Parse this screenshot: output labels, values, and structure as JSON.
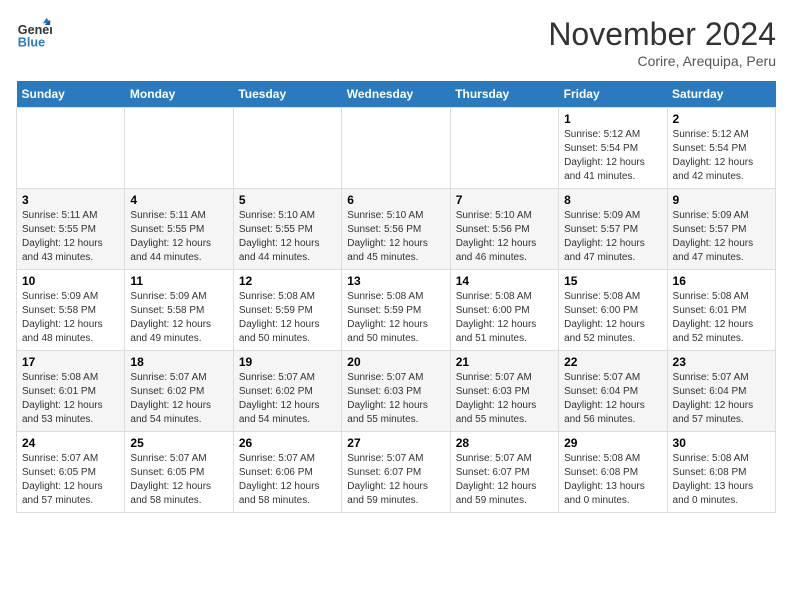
{
  "header": {
    "logo_line1": "General",
    "logo_line2": "Blue",
    "month": "November 2024",
    "location": "Corire, Arequipa, Peru"
  },
  "weekdays": [
    "Sunday",
    "Monday",
    "Tuesday",
    "Wednesday",
    "Thursday",
    "Friday",
    "Saturday"
  ],
  "weeks": [
    [
      {
        "day": "",
        "sunrise": "",
        "sunset": "",
        "daylight": ""
      },
      {
        "day": "",
        "sunrise": "",
        "sunset": "",
        "daylight": ""
      },
      {
        "day": "",
        "sunrise": "",
        "sunset": "",
        "daylight": ""
      },
      {
        "day": "",
        "sunrise": "",
        "sunset": "",
        "daylight": ""
      },
      {
        "day": "",
        "sunrise": "",
        "sunset": "",
        "daylight": ""
      },
      {
        "day": "1",
        "sunrise": "Sunrise: 5:12 AM",
        "sunset": "Sunset: 5:54 PM",
        "daylight": "Daylight: 12 hours and 41 minutes."
      },
      {
        "day": "2",
        "sunrise": "Sunrise: 5:12 AM",
        "sunset": "Sunset: 5:54 PM",
        "daylight": "Daylight: 12 hours and 42 minutes."
      }
    ],
    [
      {
        "day": "3",
        "sunrise": "Sunrise: 5:11 AM",
        "sunset": "Sunset: 5:55 PM",
        "daylight": "Daylight: 12 hours and 43 minutes."
      },
      {
        "day": "4",
        "sunrise": "Sunrise: 5:11 AM",
        "sunset": "Sunset: 5:55 PM",
        "daylight": "Daylight: 12 hours and 44 minutes."
      },
      {
        "day": "5",
        "sunrise": "Sunrise: 5:10 AM",
        "sunset": "Sunset: 5:55 PM",
        "daylight": "Daylight: 12 hours and 44 minutes."
      },
      {
        "day": "6",
        "sunrise": "Sunrise: 5:10 AM",
        "sunset": "Sunset: 5:56 PM",
        "daylight": "Daylight: 12 hours and 45 minutes."
      },
      {
        "day": "7",
        "sunrise": "Sunrise: 5:10 AM",
        "sunset": "Sunset: 5:56 PM",
        "daylight": "Daylight: 12 hours and 46 minutes."
      },
      {
        "day": "8",
        "sunrise": "Sunrise: 5:09 AM",
        "sunset": "Sunset: 5:57 PM",
        "daylight": "Daylight: 12 hours and 47 minutes."
      },
      {
        "day": "9",
        "sunrise": "Sunrise: 5:09 AM",
        "sunset": "Sunset: 5:57 PM",
        "daylight": "Daylight: 12 hours and 47 minutes."
      }
    ],
    [
      {
        "day": "10",
        "sunrise": "Sunrise: 5:09 AM",
        "sunset": "Sunset: 5:58 PM",
        "daylight": "Daylight: 12 hours and 48 minutes."
      },
      {
        "day": "11",
        "sunrise": "Sunrise: 5:09 AM",
        "sunset": "Sunset: 5:58 PM",
        "daylight": "Daylight: 12 hours and 49 minutes."
      },
      {
        "day": "12",
        "sunrise": "Sunrise: 5:08 AM",
        "sunset": "Sunset: 5:59 PM",
        "daylight": "Daylight: 12 hours and 50 minutes."
      },
      {
        "day": "13",
        "sunrise": "Sunrise: 5:08 AM",
        "sunset": "Sunset: 5:59 PM",
        "daylight": "Daylight: 12 hours and 50 minutes."
      },
      {
        "day": "14",
        "sunrise": "Sunrise: 5:08 AM",
        "sunset": "Sunset: 6:00 PM",
        "daylight": "Daylight: 12 hours and 51 minutes."
      },
      {
        "day": "15",
        "sunrise": "Sunrise: 5:08 AM",
        "sunset": "Sunset: 6:00 PM",
        "daylight": "Daylight: 12 hours and 52 minutes."
      },
      {
        "day": "16",
        "sunrise": "Sunrise: 5:08 AM",
        "sunset": "Sunset: 6:01 PM",
        "daylight": "Daylight: 12 hours and 52 minutes."
      }
    ],
    [
      {
        "day": "17",
        "sunrise": "Sunrise: 5:08 AM",
        "sunset": "Sunset: 6:01 PM",
        "daylight": "Daylight: 12 hours and 53 minutes."
      },
      {
        "day": "18",
        "sunrise": "Sunrise: 5:07 AM",
        "sunset": "Sunset: 6:02 PM",
        "daylight": "Daylight: 12 hours and 54 minutes."
      },
      {
        "day": "19",
        "sunrise": "Sunrise: 5:07 AM",
        "sunset": "Sunset: 6:02 PM",
        "daylight": "Daylight: 12 hours and 54 minutes."
      },
      {
        "day": "20",
        "sunrise": "Sunrise: 5:07 AM",
        "sunset": "Sunset: 6:03 PM",
        "daylight": "Daylight: 12 hours and 55 minutes."
      },
      {
        "day": "21",
        "sunrise": "Sunrise: 5:07 AM",
        "sunset": "Sunset: 6:03 PM",
        "daylight": "Daylight: 12 hours and 55 minutes."
      },
      {
        "day": "22",
        "sunrise": "Sunrise: 5:07 AM",
        "sunset": "Sunset: 6:04 PM",
        "daylight": "Daylight: 12 hours and 56 minutes."
      },
      {
        "day": "23",
        "sunrise": "Sunrise: 5:07 AM",
        "sunset": "Sunset: 6:04 PM",
        "daylight": "Daylight: 12 hours and 57 minutes."
      }
    ],
    [
      {
        "day": "24",
        "sunrise": "Sunrise: 5:07 AM",
        "sunset": "Sunset: 6:05 PM",
        "daylight": "Daylight: 12 hours and 57 minutes."
      },
      {
        "day": "25",
        "sunrise": "Sunrise: 5:07 AM",
        "sunset": "Sunset: 6:05 PM",
        "daylight": "Daylight: 12 hours and 58 minutes."
      },
      {
        "day": "26",
        "sunrise": "Sunrise: 5:07 AM",
        "sunset": "Sunset: 6:06 PM",
        "daylight": "Daylight: 12 hours and 58 minutes."
      },
      {
        "day": "27",
        "sunrise": "Sunrise: 5:07 AM",
        "sunset": "Sunset: 6:07 PM",
        "daylight": "Daylight: 12 hours and 59 minutes."
      },
      {
        "day": "28",
        "sunrise": "Sunrise: 5:07 AM",
        "sunset": "Sunset: 6:07 PM",
        "daylight": "Daylight: 12 hours and 59 minutes."
      },
      {
        "day": "29",
        "sunrise": "Sunrise: 5:08 AM",
        "sunset": "Sunset: 6:08 PM",
        "daylight": "Daylight: 13 hours and 0 minutes."
      },
      {
        "day": "30",
        "sunrise": "Sunrise: 5:08 AM",
        "sunset": "Sunset: 6:08 PM",
        "daylight": "Daylight: 13 hours and 0 minutes."
      }
    ]
  ]
}
